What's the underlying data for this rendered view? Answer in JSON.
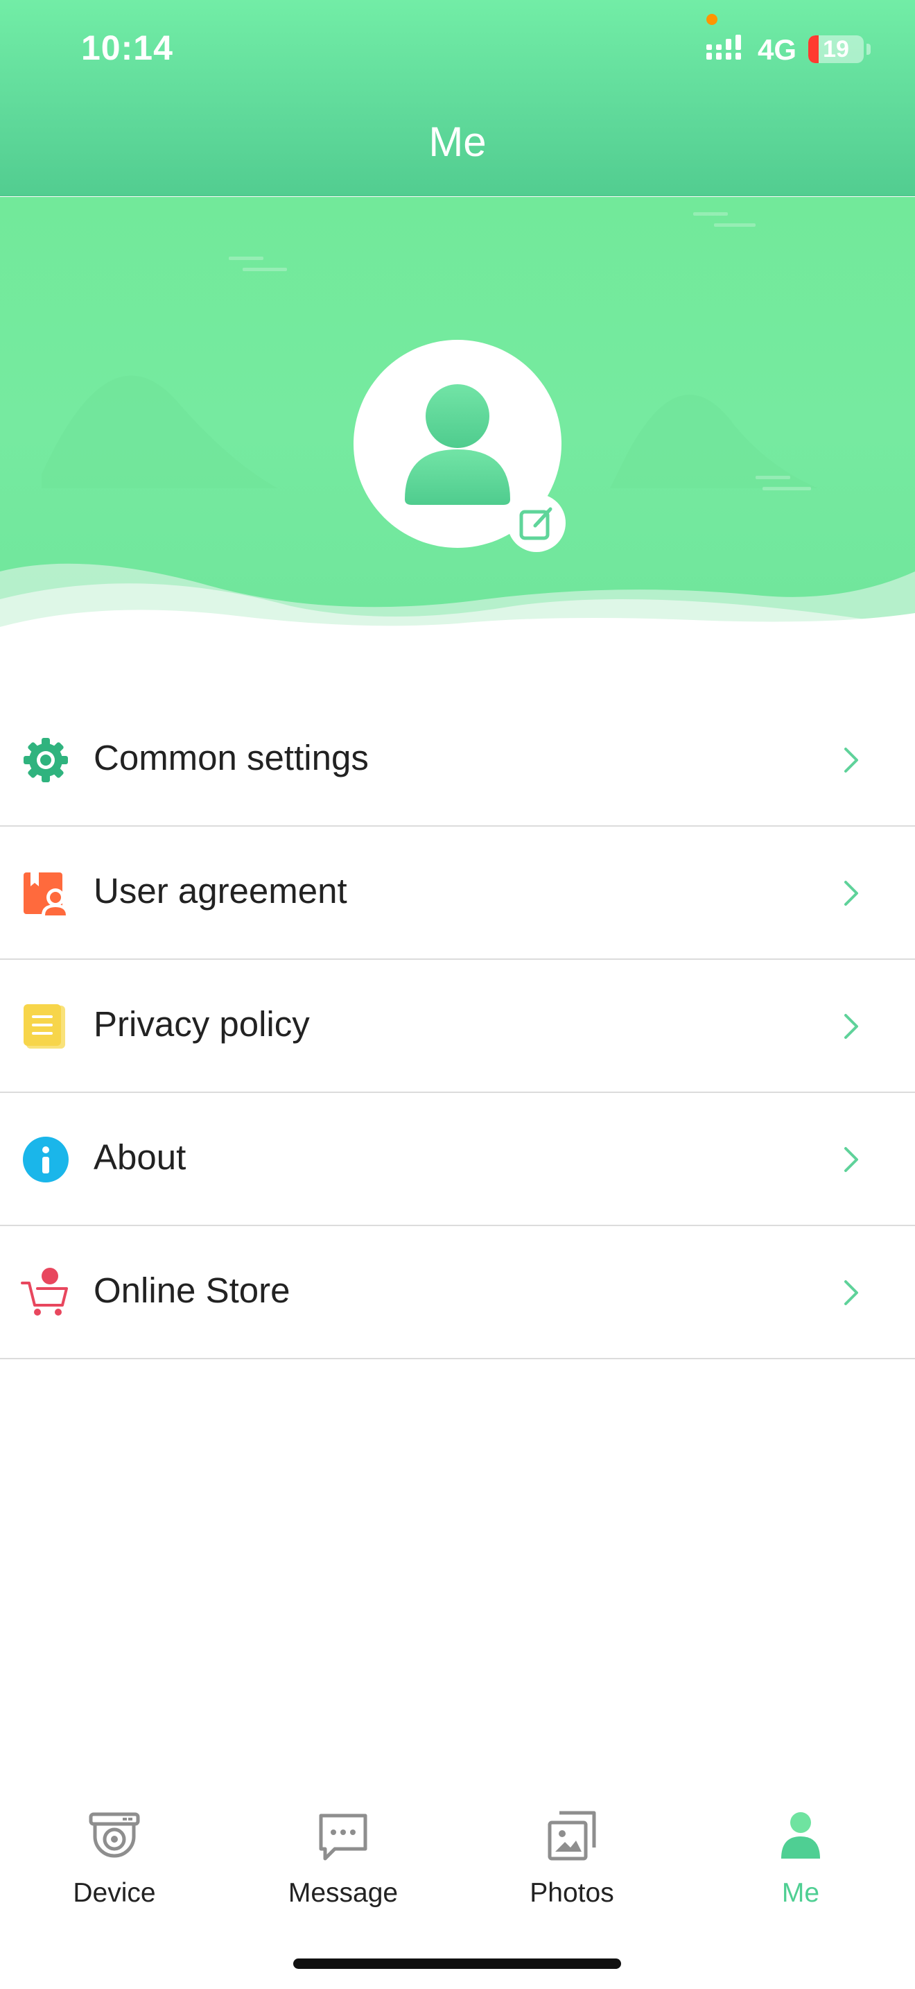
{
  "status_bar": {
    "time": "10:14",
    "network": "4G",
    "battery_level": "19",
    "battery_fraction": 0.19,
    "signal_icon": "cellular-signal-icon"
  },
  "header": {
    "title": "Me"
  },
  "profile": {
    "avatar_icon": "user-avatar-icon",
    "edit_icon": "edit-icon"
  },
  "menu": {
    "items": [
      {
        "label": "Common settings",
        "icon": "gear-icon",
        "color": "#2fb37e"
      },
      {
        "label": "User agreement",
        "icon": "agreement-icon",
        "color": "#ff6a3d"
      },
      {
        "label": "Privacy policy",
        "icon": "document-icon",
        "color": "#f7d54a"
      },
      {
        "label": "About",
        "icon": "info-icon",
        "color": "#1ab6ea"
      },
      {
        "label": "Online Store",
        "icon": "cart-icon",
        "color": "#e8475e"
      }
    ],
    "chevron_icon": "chevron-right-icon"
  },
  "tabbar": {
    "tabs": [
      {
        "label": "Device",
        "icon": "camera-device-icon"
      },
      {
        "label": "Message",
        "icon": "message-icon"
      },
      {
        "label": "Photos",
        "icon": "photos-icon"
      },
      {
        "label": "Me",
        "icon": "person-icon",
        "active": true
      }
    ]
  },
  "colors": {
    "accent": "#4fcf93",
    "header": "#5fd99a",
    "inactive_icon": "#8e8e8e"
  }
}
